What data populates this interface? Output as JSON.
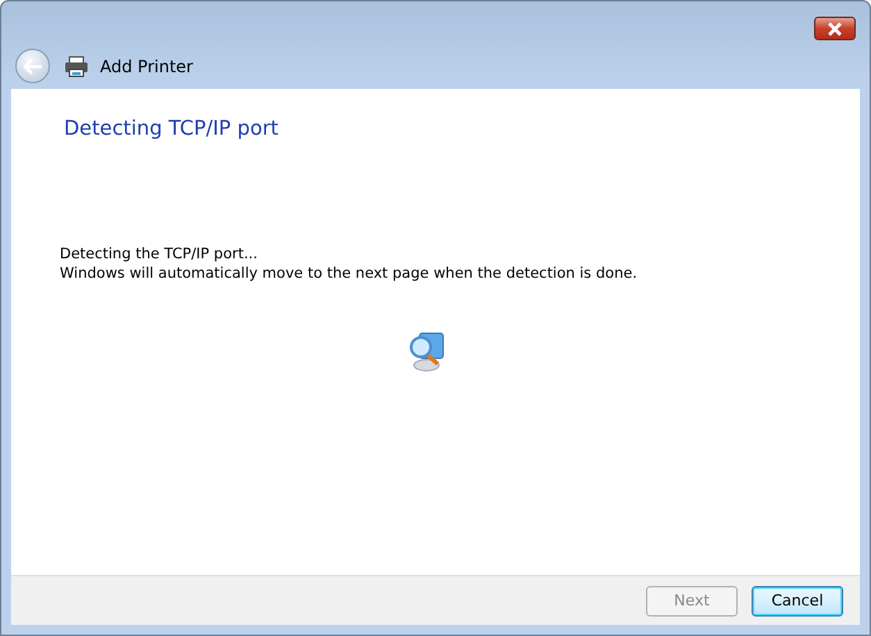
{
  "window": {
    "title": "Add Printer",
    "back_disabled": true
  },
  "heading": "Detecting TCP/IP port",
  "messages": [
    "Detecting the TCP/IP port...",
    "Windows will automatically move to the next page when the detection is done."
  ],
  "buttons": [
    {
      "label": "Next",
      "disabled": true,
      "focused": false
    },
    {
      "label": "Cancel",
      "disabled": false,
      "focused": true
    }
  ]
}
